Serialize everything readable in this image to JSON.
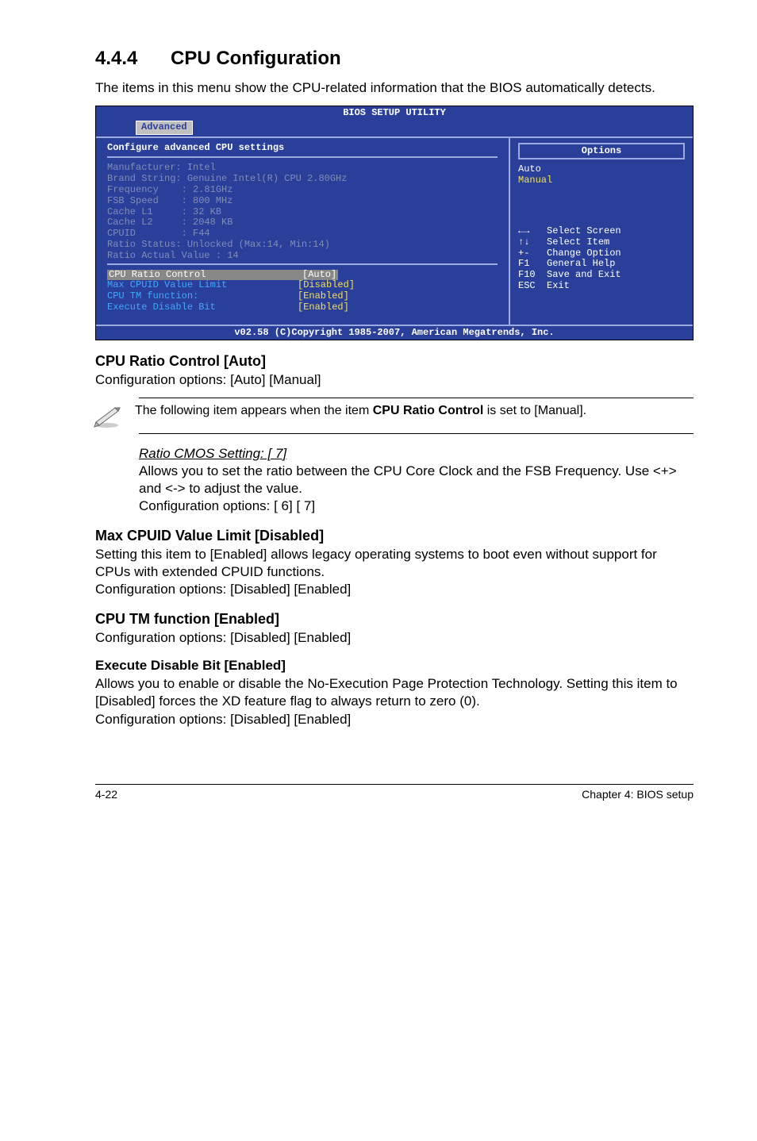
{
  "sec_num": "4.4.4",
  "sec_title": "CPU Configuration",
  "intro": "The items in this menu show the CPU-related information that the BIOS automatically detects.",
  "bios": {
    "title": "BIOS SETUP UTILITY",
    "tab": "Advanced",
    "heading": "Configure advanced CPU settings",
    "options_label": "Options",
    "options": {
      "auto": "Auto",
      "manual": "Manual"
    },
    "cpu": {
      "l0": "Manufacturer: Intel",
      "l1": "Brand String: Genuine Intel(R) CPU 2.80GHz",
      "l2": "Frequency    : 2.81GHz",
      "l3": "FSB Speed    : 800 MHz",
      "l4": "Cache L1     : 32 KB",
      "l5": "Cache L2     : 2048 KB",
      "l6": "CPUID        : F44",
      "l7": "Ratio Status: Unlocked (Max:14, Min:14)",
      "l8": "Ratio Actual Value : 14"
    },
    "settings": {
      "r0": {
        "label": "CPU Ratio Control",
        "val": "[Auto]"
      },
      "r1": {
        "label": "Max CPUID Value Limit",
        "val": "[Disabled]"
      },
      "r2": {
        "label": "CPU TM function:",
        "val": "[Enabled]"
      },
      "r3": {
        "label": "Execute Disable Bit",
        "val": "[Enabled]"
      }
    },
    "legend": {
      "l0": "←→   Select Screen",
      "l1": "↑↓   Select Item",
      "l2": "+-   Change Option",
      "l3": "F1   General Help",
      "l4": "F10  Save and Exit",
      "l5": "ESC  Exit"
    },
    "footer": "v02.58 (C)Copyright 1985-2007, American Megatrends, Inc."
  },
  "cpu_ratio": {
    "h": "CPU Ratio Control [Auto]",
    "p": "Configuration options: [Auto] [Manual]"
  },
  "note": {
    "t1": "The following item appears when the item ",
    "bold": "CPU Ratio Control",
    "t2": " is set to [Manual]."
  },
  "ratio_cmos": {
    "h": "Ratio CMOS Setting: [ 7]",
    "p1": "Allows you to set the ratio between the CPU Core Clock and the FSB Frequency. Use <+> and <-> to adjust the value.",
    "p2": "Configuration options: [ 6] [ 7]"
  },
  "max_cpuid": {
    "h": "Max CPUID Value Limit [Disabled]",
    "p1": "Setting this item to [Enabled] allows legacy operating systems to boot even without support for CPUs with extended CPUID functions.",
    "p2": "Configuration options: [Disabled] [Enabled]"
  },
  "cpu_tm": {
    "h": "CPU TM function [Enabled]",
    "p": "Configuration options: [Disabled] [Enabled]"
  },
  "exec_disable": {
    "h": "Execute Disable Bit [Enabled]",
    "p1": "Allows you to enable or disable the No-Execution Page Protection Technology. Setting this item to [Disabled] forces the XD feature flag to always return to zero (0).",
    "p2": "Configuration options: [Disabled] [Enabled]"
  },
  "footer": {
    "left": "4-22",
    "right": "Chapter 4: BIOS setup"
  }
}
